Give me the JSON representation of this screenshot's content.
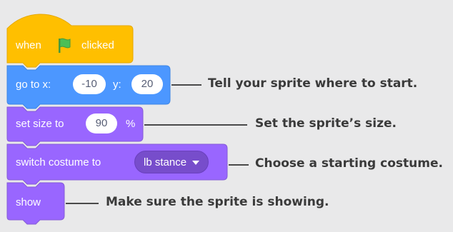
{
  "blocks": {
    "event": {
      "when_label": "when",
      "flag_icon": "green-flag-icon",
      "clicked_label": "clicked",
      "color": "#ffbf00"
    },
    "goto": {
      "prefix": "go to x:",
      "x_value": "-10",
      "y_label": "y:",
      "y_value": "20",
      "color": "#4c97ff"
    },
    "setsize": {
      "prefix": "set size to",
      "value": "90",
      "suffix": "%",
      "color": "#9966ff"
    },
    "costume": {
      "prefix": "switch costume to",
      "selected": "lb stance",
      "color": "#9966ff"
    },
    "show": {
      "label": "show",
      "color": "#9966ff"
    }
  },
  "callouts": {
    "goto": "Tell your sprite where to start.",
    "setsize": "Set the sprite’s size.",
    "costume": "Choose a starting costume.",
    "show": "Make sure the sprite is showing."
  }
}
